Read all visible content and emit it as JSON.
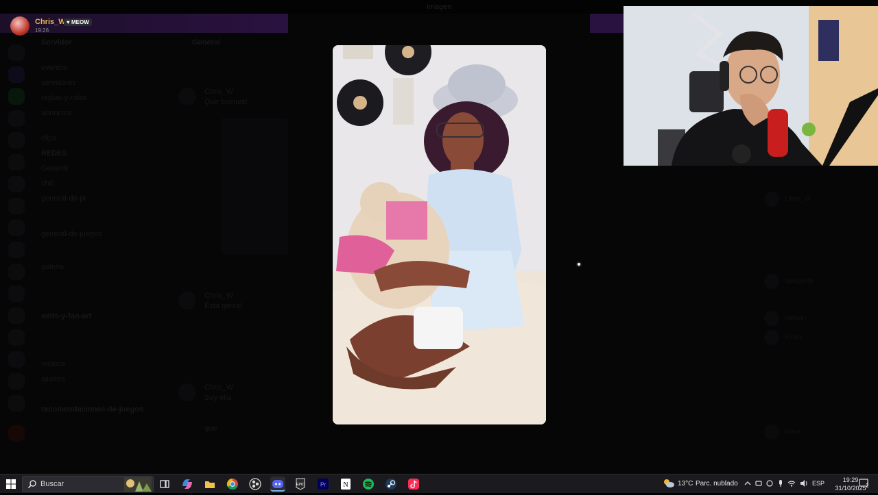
{
  "window": {
    "title": "Imagen"
  },
  "streamer": {
    "name": "Chris_W",
    "badge": "♥ MEOW",
    "time": "19:26"
  },
  "channels": {
    "items": [
      "Servidor",
      "eventos",
      "servidores",
      "reglas-y-roles",
      "anuncios",
      "clips",
      "REDES",
      "General",
      "chill",
      "general-de-pr",
      "general-de-juegos",
      "galeria",
      "edits-y-fan-art",
      "musica",
      "ajustes",
      "recomendaciones-de-juegos"
    ]
  },
  "chat": {
    "header": "General",
    "author": "Chris_W",
    "messages": [
      "Que buenas!",
      "Esta genial",
      "Soy ella",
      "que"
    ]
  },
  "members": [
    "Chris_W",
    "Nekoshin",
    "Herwin",
    "Kiriko",
    "Nova"
  ],
  "taskbar": {
    "search_placeholder": "Buscar",
    "apps": [
      "task-view",
      "copilot",
      "file-explorer",
      "chrome",
      "obs",
      "discord",
      "epic-games",
      "premiere-pro",
      "notion",
      "spotify",
      "steam",
      "tiktok"
    ],
    "weather_temp": "13°C",
    "weather_desc": "Parc. nublado",
    "language": "ESP",
    "clock_time": "19:29",
    "clock_date": "31/10/2025",
    "notification_count": "2"
  },
  "colors": {
    "accent_gold": "#e8b84a",
    "purple": "#2a1240",
    "taskbar": "#1b1b1f"
  }
}
